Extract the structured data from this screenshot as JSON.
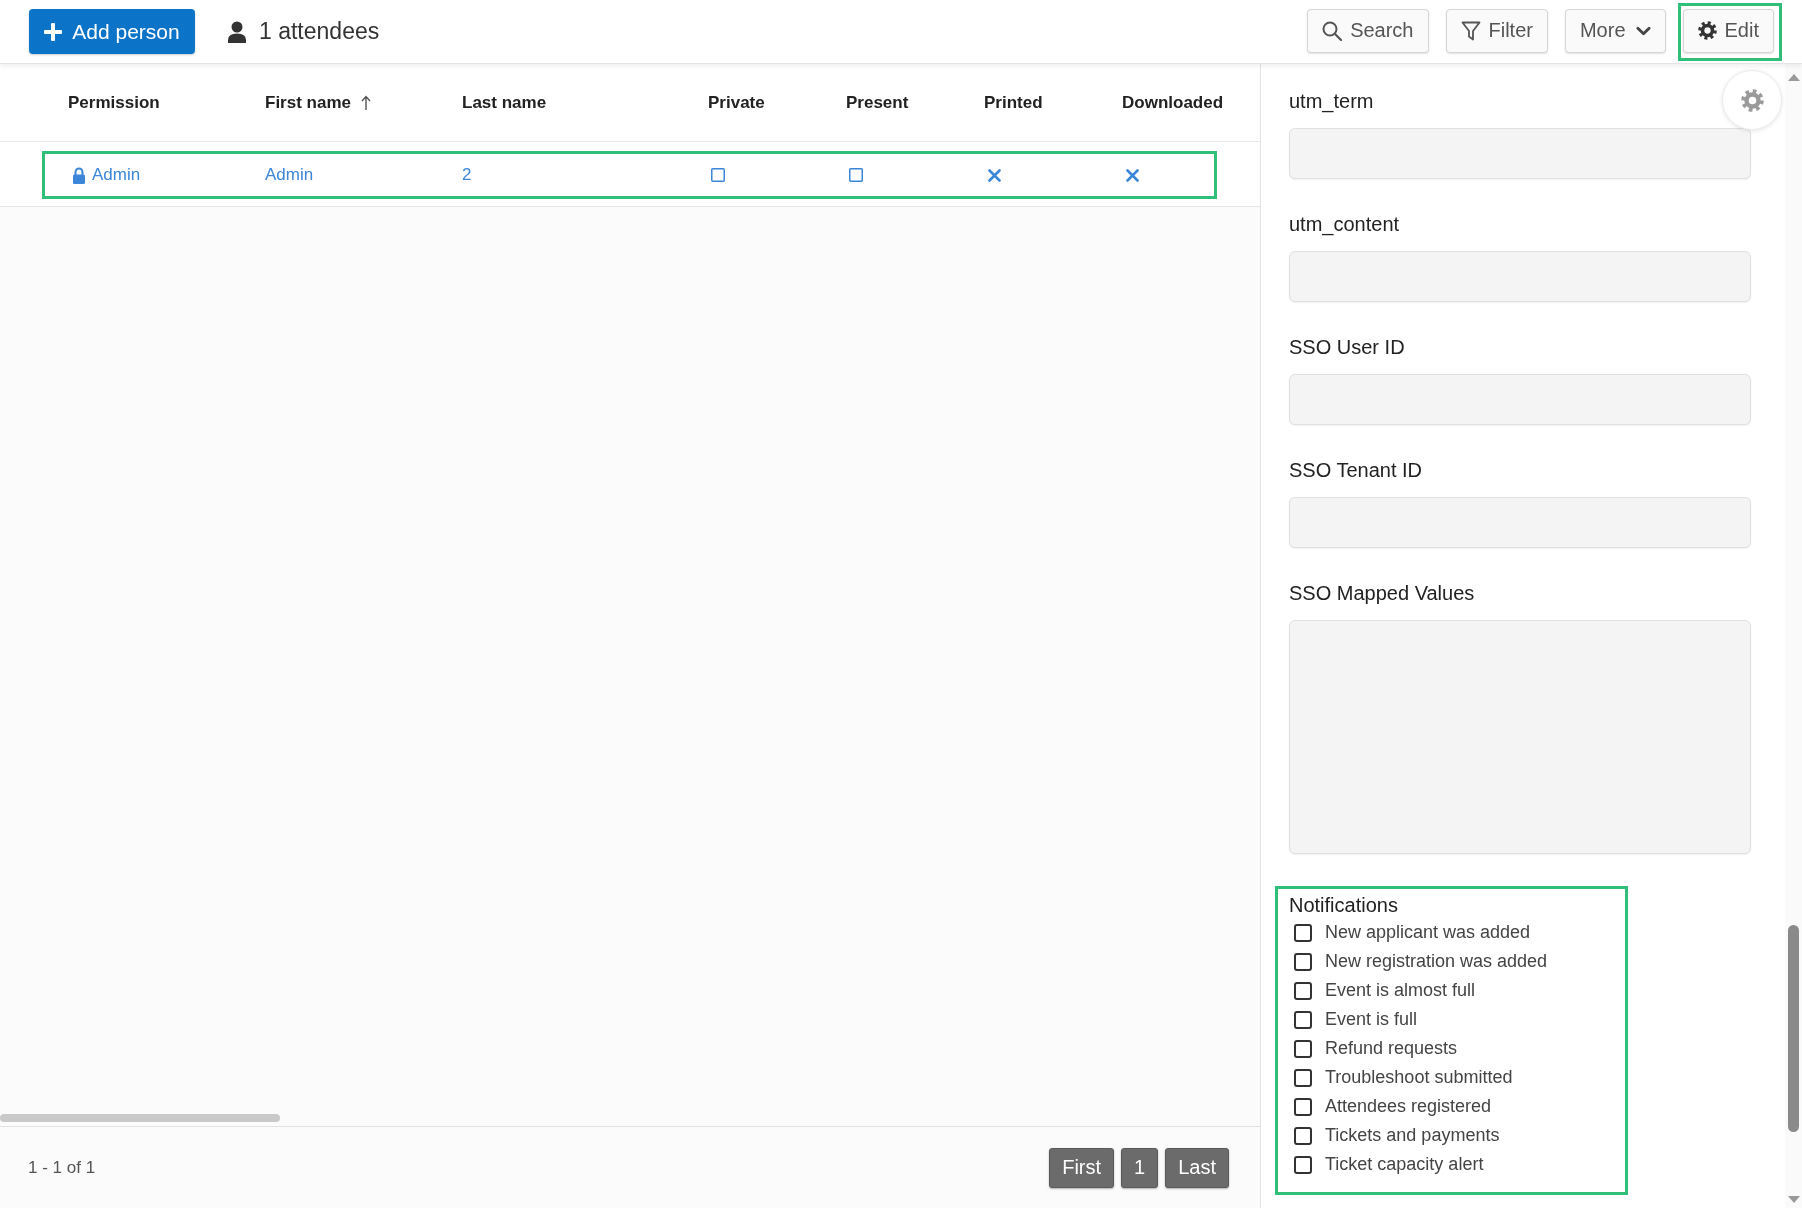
{
  "toolbar": {
    "add_button": "Add person",
    "attendee_count": "1 attendees",
    "actions": [
      {
        "kind": "search",
        "label": "Search",
        "highlighted": false
      },
      {
        "kind": "filter",
        "label": "Filter",
        "highlighted": false
      },
      {
        "kind": "more",
        "label": "More",
        "highlighted": false
      },
      {
        "kind": "edit",
        "label": "Edit",
        "highlighted": true
      }
    ]
  },
  "table": {
    "columns": [
      {
        "label": "Permission"
      },
      {
        "label": "First name",
        "sorted": true
      },
      {
        "label": "Last name"
      },
      {
        "label": "Private"
      },
      {
        "label": "Present"
      },
      {
        "label": "Printed"
      },
      {
        "label": "Downloaded"
      }
    ],
    "rows": [
      {
        "highlighted": true,
        "permission": "Admin",
        "first_name": "Admin",
        "last_name": "2",
        "private": false,
        "present": false,
        "printed": false,
        "downloaded": false
      }
    ]
  },
  "footer": {
    "range": "1 - 1 of 1",
    "pages": [
      "First",
      "1",
      "Last"
    ]
  },
  "side_panel": {
    "fields": [
      {
        "label": "utm_term",
        "kind": "input"
      },
      {
        "label": "utm_content",
        "kind": "input"
      },
      {
        "label": "SSO User ID",
        "kind": "input"
      },
      {
        "label": "SSO Tenant ID",
        "kind": "input"
      },
      {
        "label": "SSO Mapped Values",
        "kind": "textarea"
      }
    ],
    "notifications": {
      "title": "Notifications",
      "highlighted": true,
      "items": [
        {
          "label": "New applicant was added",
          "checked": false
        },
        {
          "label": "New registration was added",
          "checked": false
        },
        {
          "label": "Event is almost full",
          "checked": false
        },
        {
          "label": "Event is full",
          "checked": false
        },
        {
          "label": "Refund requests",
          "checked": false
        },
        {
          "label": "Troubleshoot submitted",
          "checked": false
        },
        {
          "label": "Attendees registered",
          "checked": false
        },
        {
          "label": "Tickets and payments",
          "checked": false
        },
        {
          "label": "Ticket capacity alert",
          "checked": false
        }
      ]
    }
  }
}
